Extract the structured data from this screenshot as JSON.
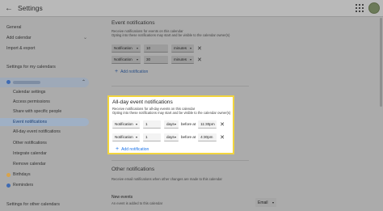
{
  "app": {
    "title": "Settings"
  },
  "sidebar": {
    "general": "General",
    "add_calendar": "Add calendar",
    "import_export": "Import & export",
    "my_calendars_heading": "Settings for my calendars",
    "sub_items": [
      "Calendar settings",
      "Access permissions",
      "Share with specific people",
      "Event notifications",
      "All-day event notifications",
      "Other notifications",
      "Integrate calendar",
      "Remove calendar"
    ],
    "birthdays": "Birthdays",
    "reminders": "Reminders",
    "other_calendars_heading": "Settings for other calendars",
    "colors": {
      "calendar": "#3f6bb3",
      "birthdays": "#d9a34a",
      "reminders": "#3f6bb3"
    }
  },
  "event_notifications": {
    "title": "Event notifications",
    "desc1": "Receive notifications for events on this calendar",
    "desc2": "Opting into these notifications may start and be visible to the calendar owner(s)",
    "rows": [
      {
        "type": "Notification",
        "amount": "10",
        "unit": "minutes"
      },
      {
        "type": "Notification",
        "amount": "30",
        "unit": "minutes"
      }
    ],
    "add_label": "Add notification"
  },
  "allday_notifications": {
    "title": "All-day event notifications",
    "desc1": "Receive notifications for all-day events on this calendar",
    "desc2": "Opting into these notifications may start and be visible to the calendar owner(s)",
    "rows": [
      {
        "type": "Notification",
        "amount": "1",
        "unit": "days",
        "before_at": "before at",
        "time": "11:30pm"
      },
      {
        "type": "Notification",
        "amount": "1",
        "unit": "days",
        "before_at": "before at",
        "time": "4:30pm"
      }
    ],
    "add_label": "Add notification"
  },
  "other_notifications": {
    "title": "Other notifications",
    "desc": "Receive email notifications when other changes are made to this calendar",
    "new_events_title": "New events",
    "new_events_desc": "An event is added to this calendar",
    "email_label": "Email"
  }
}
